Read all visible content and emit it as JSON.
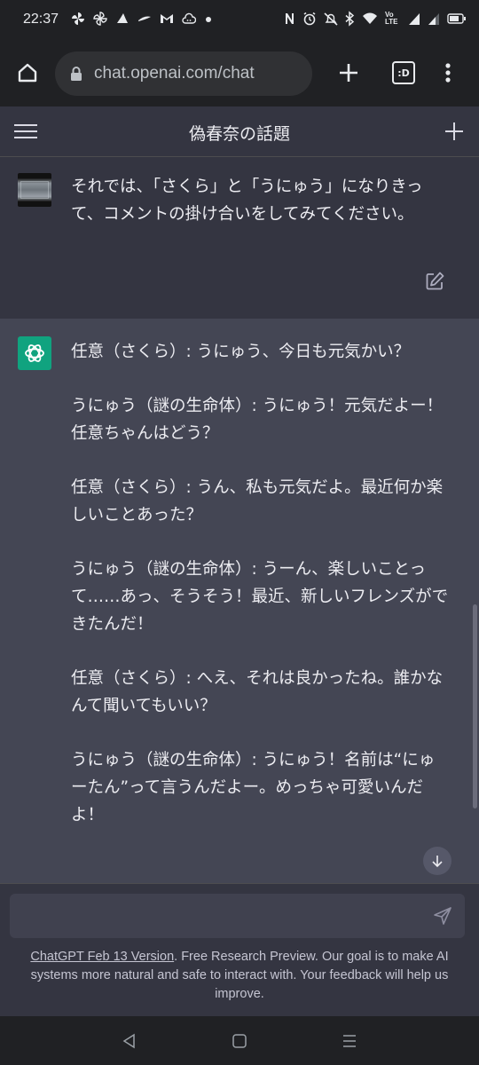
{
  "status_bar": {
    "time": "22:37",
    "notification_icons": [
      "pinwheel-icon",
      "pinwheel-icon",
      "hat-icon",
      "ink-icon",
      "gmail-icon",
      "cloud-face-icon",
      "dot-icon"
    ],
    "system_icons": [
      "nfc-icon",
      "alarm-icon",
      "mute-icon",
      "bluetooth-icon",
      "wifi-icon",
      "volte-icon",
      "signal-icon",
      "signal-icon",
      "battery-icon"
    ],
    "volte_label": "Vo LTE"
  },
  "browser": {
    "url": "chat.openai.com/chat",
    "tab_indicator": ":D"
  },
  "chat": {
    "title": "偽春奈の話題",
    "user_message": "それでは、「さくら」と「うにゅう」になりきって、コメントの掛け合いをしてみてください。",
    "assistant_paragraphs": [
      "任意（さくら）: うにゅう、今日も元気かい？",
      "うにゅう（謎の生命体）: うにゅう！元気だよー！任意ちゃんはどう？",
      "任意（さくら）: うん、私も元気だよ。最近何か楽しいことあった？",
      "うにゅう（謎の生命体）: うーん、楽しいことって……あっ、そうそう！最近、新しいフレンズができたんだ！",
      "任意（さくら）: へえ、それは良かったね。誰かなんて聞いてもいい？",
      "うにゅう（謎の生命体）: うにゅう！名前は“にゅーたん”って言うんだよー。めっちゃ可愛いんだよ！"
    ]
  },
  "composer": {
    "value": "",
    "placeholder": ""
  },
  "footer": {
    "version_link": "ChatGPT Feb 13 Version",
    "text": ". Free Research Preview. Our goal is to make AI systems more natural and safe to interact with. Your feedback will help us improve."
  },
  "colors": {
    "page_bg": "#343541",
    "assistant_bg": "#444654",
    "composer_bg": "#40414f",
    "browser_bg": "#202124",
    "gpt_green": "#10a37f"
  }
}
